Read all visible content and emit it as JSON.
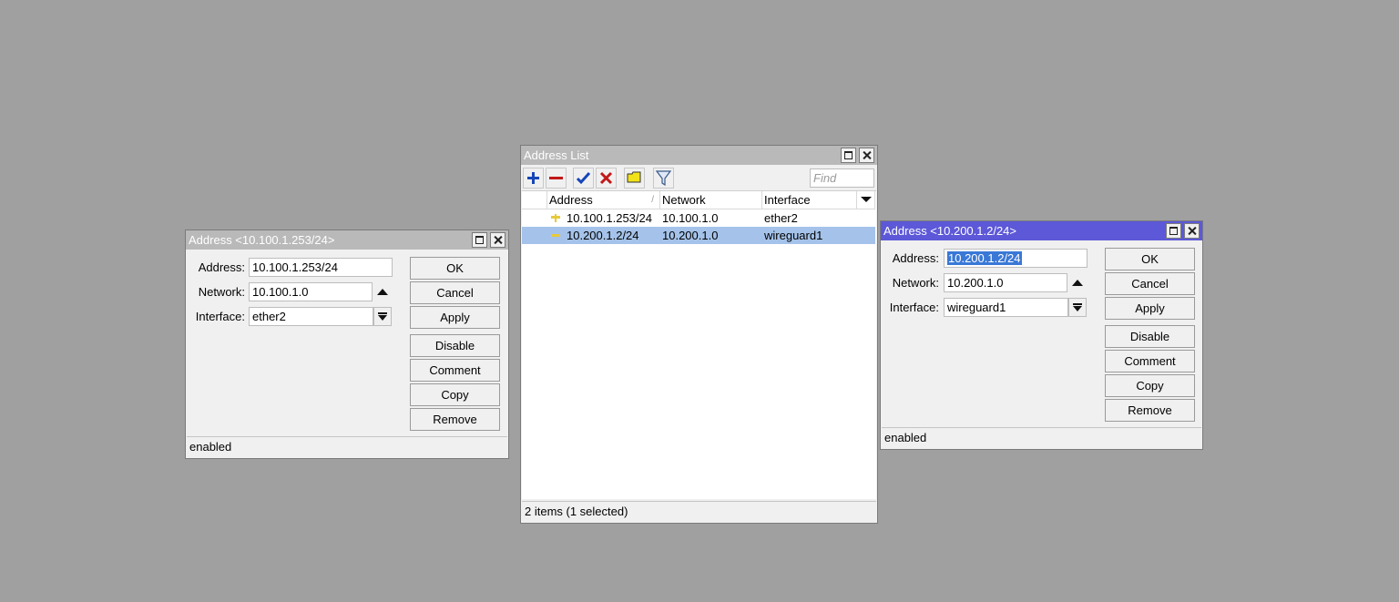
{
  "address_dialog_left": {
    "title": "Address <10.100.1.253/24>",
    "labels": {
      "address": "Address:",
      "network": "Network:",
      "interface": "Interface:"
    },
    "values": {
      "address": "10.100.1.253/24",
      "network": "10.100.1.0",
      "interface": "ether2"
    },
    "buttons": {
      "ok": "OK",
      "cancel": "Cancel",
      "apply": "Apply",
      "disable": "Disable",
      "comment": "Comment",
      "copy": "Copy",
      "remove": "Remove"
    },
    "status": "enabled"
  },
  "address_list": {
    "title": "Address List",
    "find_placeholder": "Find",
    "columns": {
      "address": "Address",
      "network": "Network",
      "interface": "Interface"
    },
    "rows": [
      {
        "address": "10.100.1.253/24",
        "network": "10.100.1.0",
        "interface": "ether2",
        "selected": false
      },
      {
        "address": "10.200.1.2/24",
        "network": "10.200.1.0",
        "interface": "wireguard1",
        "selected": true
      }
    ],
    "status": "2 items (1 selected)",
    "toolbar_icons": [
      "add-icon",
      "remove-icon",
      "enable-icon",
      "disable-icon",
      "comment-icon",
      "filter-icon"
    ]
  },
  "address_dialog_right": {
    "title": "Address <10.200.1.2/24>",
    "labels": {
      "address": "Address:",
      "network": "Network:",
      "interface": "Interface:"
    },
    "values": {
      "address": "10.200.1.2/24",
      "network": "10.200.1.0",
      "interface": "wireguard1"
    },
    "buttons": {
      "ok": "OK",
      "cancel": "Cancel",
      "apply": "Apply",
      "disable": "Disable",
      "comment": "Comment",
      "copy": "Copy",
      "remove": "Remove"
    },
    "status": "enabled"
  },
  "colors": {
    "desktop": "#a0a0a0",
    "active_title": "#5c58d8",
    "inactive_title": "#b9b9b9",
    "selected_row": "#a5c3ea"
  }
}
